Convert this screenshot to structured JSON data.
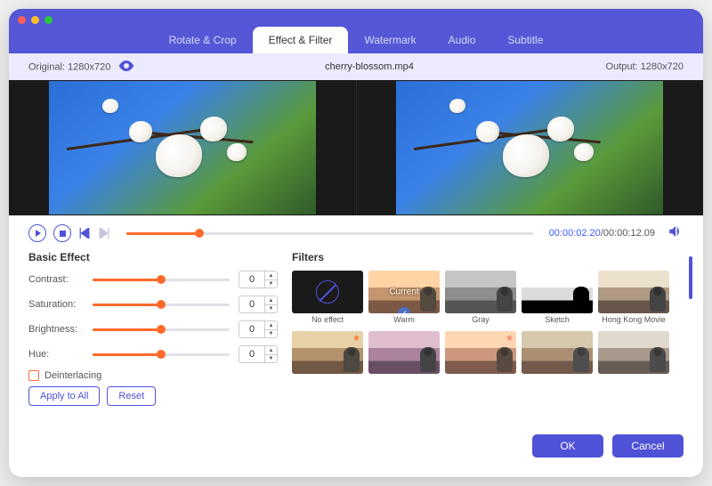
{
  "tabs": [
    "Rotate & Crop",
    "Effect & Filter",
    "Watermark",
    "Audio",
    "Subtitle"
  ],
  "active_tab": "Effect & Filter",
  "original_label": "Original: 1280x720",
  "output_label": "Output: 1280x720",
  "filename": "cherry-blossom.mp4",
  "time": {
    "current": "00:00:02.20",
    "duration": "00:00:12.09",
    "progress_pct": 18
  },
  "basic": {
    "title": "Basic Effect",
    "params": [
      {
        "label": "Contrast:",
        "value": 0,
        "pct": 50
      },
      {
        "label": "Saturation:",
        "value": 0,
        "pct": 50
      },
      {
        "label": "Brightness:",
        "value": 0,
        "pct": 50
      },
      {
        "label": "Hue:",
        "value": 0,
        "pct": 50
      }
    ],
    "deinterlacing": "Deinterlacing",
    "apply": "Apply to All",
    "reset": "Reset"
  },
  "filters": {
    "title": "Filters",
    "current_label": "Current",
    "items": [
      {
        "label": "No effect",
        "variant": "none"
      },
      {
        "label": "Warm",
        "variant": "warm",
        "selected": true,
        "checked": true
      },
      {
        "label": "Gray",
        "variant": "gray"
      },
      {
        "label": "Sketch",
        "variant": "sketch"
      },
      {
        "label": "Hong Kong Movie",
        "variant": "hk"
      },
      {
        "label": "",
        "variant": "f6",
        "star": true
      },
      {
        "label": "",
        "variant": "f7"
      },
      {
        "label": "",
        "variant": "f8",
        "star": true
      },
      {
        "label": "",
        "variant": "f9"
      },
      {
        "label": "",
        "variant": "f10"
      }
    ]
  },
  "footer": {
    "ok": "OK",
    "cancel": "Cancel"
  }
}
